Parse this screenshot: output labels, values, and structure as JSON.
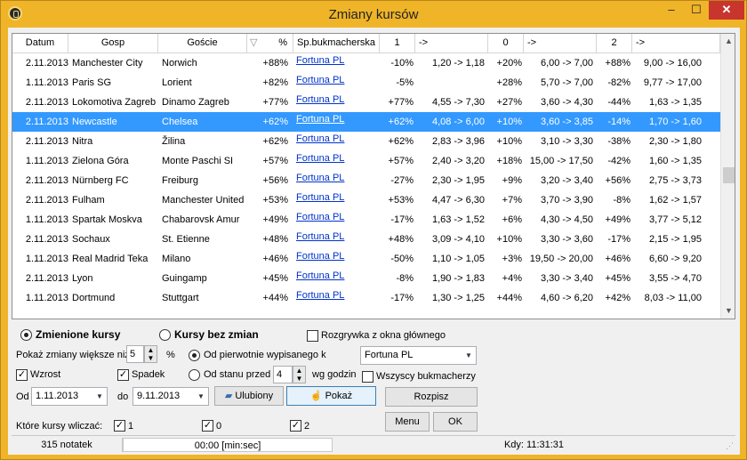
{
  "window": {
    "title": "Zmiany kursów",
    "minimize": "–",
    "maximize": "☐",
    "close": "✕"
  },
  "table": {
    "headers": [
      "Datum",
      "Gosp",
      "Goście",
      "%",
      "Sp.bukmacherska",
      "1",
      "->",
      "0",
      "->",
      "2",
      "->"
    ],
    "sort_indicator": "▽",
    "selected_row": 3,
    "rows": [
      [
        "2.11.2013",
        "Manchester City",
        "Norwich",
        "+88%",
        "Fortuna PL",
        "-10%",
        "1,20 -> 1,18",
        "+20%",
        "6,00 -> 7,00",
        "+88%",
        "9,00 -> 16,00"
      ],
      [
        "1.11.2013",
        "Paris SG",
        "Lorient",
        "+82%",
        "Fortuna PL",
        "-5%",
        "",
        "+28%",
        "5,70 -> 7,00",
        "-82%",
        "9,77 -> 17,00"
      ],
      [
        "2.11.2013",
        "Lokomotiva Zagreb",
        "Dinamo Zagreb",
        "+77%",
        "Fortuna PL",
        "+77%",
        "4,55 -> 7,30",
        "+27%",
        "3,60 -> 4,30",
        "-44%",
        "1,63 -> 1,35"
      ],
      [
        "2.11.2013",
        "Newcastle",
        "Chelsea",
        "+62%",
        "Fortuna PL",
        "+62%",
        "4,08 -> 6,00",
        "+10%",
        "3,60 -> 3,85",
        "-14%",
        "1,70 -> 1,60"
      ],
      [
        "2.11.2013",
        "Nitra",
        "Žilina",
        "+62%",
        "Fortuna PL",
        "+62%",
        "2,83 -> 3,96",
        "+10%",
        "3,10 -> 3,30",
        "-38%",
        "2,30 -> 1,80"
      ],
      [
        "1.11.2013",
        "Zielona Góra",
        "Monte Paschi SI",
        "+57%",
        "Fortuna PL",
        "+57%",
        "2,40 -> 3,20",
        "+18%",
        "15,00 -> 17,50",
        "-42%",
        "1,60 -> 1,35"
      ],
      [
        "2.11.2013",
        "Nürnberg FC",
        "Freiburg",
        "+56%",
        "Fortuna PL",
        "-27%",
        "2,30 -> 1,95",
        "+9%",
        "3,20 -> 3,40",
        "+56%",
        "2,75 -> 3,73"
      ],
      [
        "2.11.2013",
        "Fulham",
        "Manchester United",
        "+53%",
        "Fortuna PL",
        "+53%",
        "4,47 -> 6,30",
        "+7%",
        "3,70 -> 3,90",
        "-8%",
        "1,62 -> 1,57"
      ],
      [
        "1.11.2013",
        "Spartak Moskva",
        "Chabarovsk Amur",
        "+49%",
        "Fortuna PL",
        "-17%",
        "1,63 -> 1,52",
        "+6%",
        "4,30 -> 4,50",
        "+49%",
        "3,77 -> 5,12"
      ],
      [
        "2.11.2013",
        "Sochaux",
        "St. Etienne",
        "+48%",
        "Fortuna PL",
        "+48%",
        "3,09 -> 4,10",
        "+10%",
        "3,30 -> 3,60",
        "-17%",
        "2,15 -> 1,95"
      ],
      [
        "1.11.2013",
        "Real Madrid Teka",
        "Milano",
        "+46%",
        "Fortuna PL",
        "-50%",
        "1,10 -> 1,05",
        "+3%",
        "19,50 -> 20,00",
        "+46%",
        "6,60 -> 9,20"
      ],
      [
        "2.11.2013",
        "Lyon",
        "Guingamp",
        "+45%",
        "Fortuna PL",
        "-8%",
        "1,90 -> 1,83",
        "+4%",
        "3,30 -> 3,40",
        "+45%",
        "3,55 -> 4,70"
      ],
      [
        "1.11.2013",
        "Dortmund",
        "Stuttgart",
        "+44%",
        "Fortuna PL",
        "-17%",
        "1,30 -> 1,25",
        "+44%",
        "4,60 -> 6,20",
        "+42%",
        "8,03 -> 11,00"
      ]
    ]
  },
  "scrollbar": {
    "up": "▲",
    "down": "▼"
  },
  "controls": {
    "mode_changed": "Zmienione kursy",
    "mode_unchanged": "Kursy bez zmian",
    "from_main_window": "Rozgrywka z okna głównego",
    "show_changes_label": "Pokaż zmiany większe niż",
    "threshold_value": "5",
    "percent": "%",
    "spin_up": "▲",
    "spin_down": "▼",
    "from_first_listed": "Od pierwotnie wypisanego k",
    "bookmaker_value": "Fortuna PL",
    "combo_arrow": "▼",
    "rise": "Wzrost",
    "fall": "Spadek",
    "check_mark": "✓",
    "from_state_before": "Od stanu przed",
    "hours_value": "4",
    "hours_suffix": "wg godzin",
    "all_bookmakers": "Wszyscy bukmacherzy",
    "from_label": "Od",
    "from_date": "1.11.2013",
    "to_label": "do",
    "to_date": "9.11.2013",
    "favorites_button": "Ulubiony",
    "show_button": "Pokaż",
    "print_button": "Rozpisz",
    "which_odds_label": "Które kursy wliczać:",
    "odds_1": "1",
    "odds_0": "0",
    "odds_2": "2",
    "menu_button": "Menu",
    "ok_button": "OK"
  },
  "status": {
    "notes": "315 notatek",
    "timer": "00:00  [min:sec]",
    "time": "Kdy: 11:31:31"
  },
  "colors": {
    "titlebar": "#f0b429",
    "selection": "#3399ff",
    "link": "#0033cc",
    "close": "#c7352d"
  }
}
